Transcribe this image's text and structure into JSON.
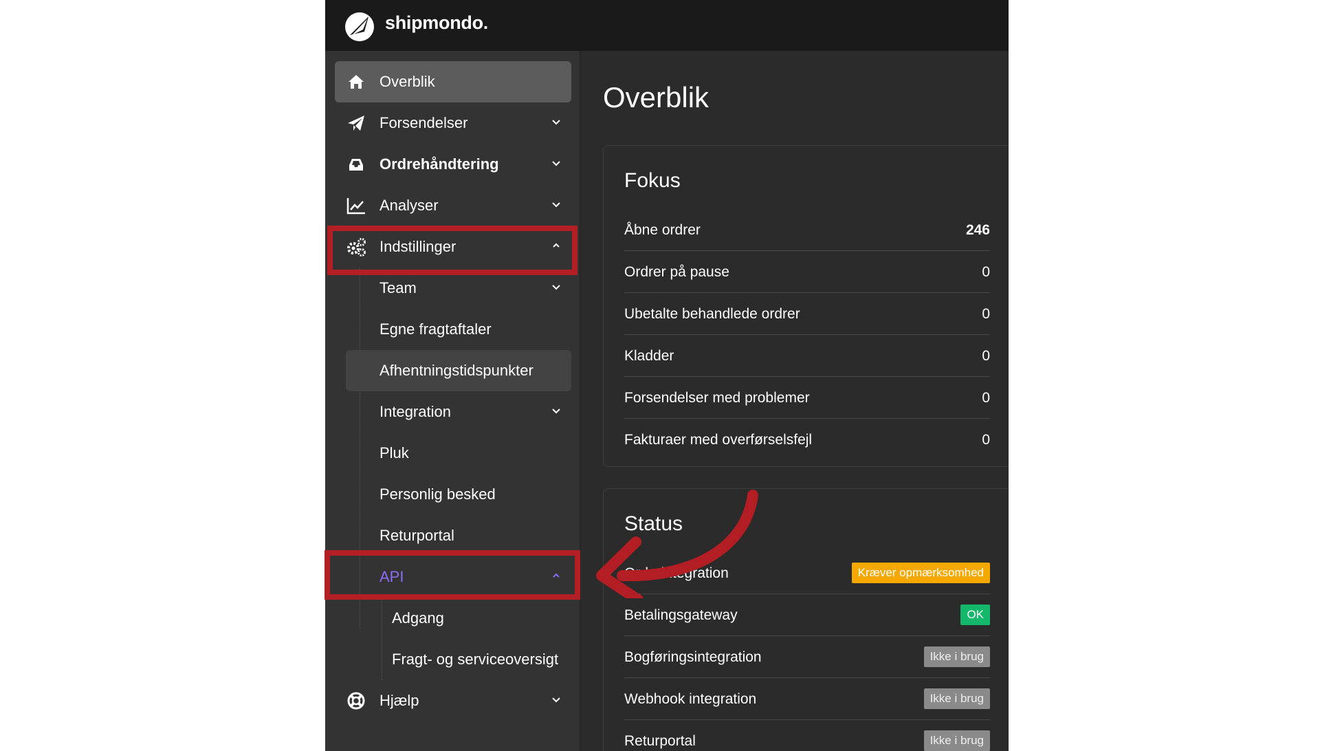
{
  "brand": {
    "name": "shipmondo.",
    "logo_icon": "shipmondo-logo-icon"
  },
  "sidebar": {
    "items": [
      {
        "label": "Overblik",
        "icon": "home-icon"
      },
      {
        "label": "Forsendelser",
        "icon": "paper-plane-icon"
      },
      {
        "label": "Ordrehåndtering",
        "icon": "inbox-icon"
      },
      {
        "label": "Analyser",
        "icon": "line-chart-icon"
      },
      {
        "label": "Indstillinger",
        "icon": "gears-icon"
      },
      {
        "label": "Hjælp",
        "icon": "lifebuoy-icon"
      }
    ],
    "settings_children": [
      {
        "label": "Team"
      },
      {
        "label": "Egne fragtaftaler"
      },
      {
        "label": "Afhentningstidspunkter"
      },
      {
        "label": "Integration"
      },
      {
        "label": "Pluk"
      },
      {
        "label": "Personlig besked"
      },
      {
        "label": "Returportal"
      },
      {
        "label": "API"
      }
    ],
    "api_children": [
      {
        "label": "Adgang"
      },
      {
        "label": "Fragt- og serviceoversigt"
      }
    ]
  },
  "main": {
    "title": "Overblik",
    "focus": {
      "title": "Fokus",
      "rows": [
        {
          "label": "Åbne ordrer",
          "value": "246"
        },
        {
          "label": "Ordrer på pause",
          "value": "0"
        },
        {
          "label": "Ubetalte behandlede ordrer",
          "value": "0"
        },
        {
          "label": "Kladder",
          "value": "0"
        },
        {
          "label": "Forsendelser med problemer",
          "value": "0"
        },
        {
          "label": "Fakturaer med overførselsfejl",
          "value": "0"
        }
      ]
    },
    "status": {
      "title": "Status",
      "rows": [
        {
          "label": "Ordreintegration",
          "badge": "Kræver opmærksomhed"
        },
        {
          "label": "Betalingsgateway",
          "badge": "OK"
        },
        {
          "label": "Bogføringsintegration",
          "badge": "Ikke i brug"
        },
        {
          "label": "Webhook integration",
          "badge": "Ikke i brug"
        },
        {
          "label": "Returportal",
          "badge": "Ikke i brug"
        }
      ]
    }
  },
  "colors": {
    "highlight": "#b31e24",
    "warn": "#f5a800",
    "ok": "#14b86b",
    "neutral": "#8a8a8a",
    "api_accent": "#8e6cf5"
  }
}
